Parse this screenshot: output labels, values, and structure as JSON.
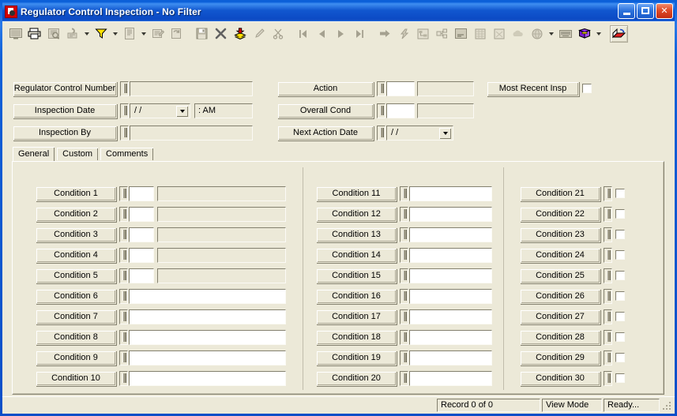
{
  "window": {
    "title": "Regulator Control Inspection - No Filter",
    "icon": "app-icon",
    "minimize_label": "Minimize",
    "maximize_label": "Maximize",
    "close_label": "Close"
  },
  "toolbar": {
    "groups": [
      {
        "buttons": [
          {
            "name": "screen-view-icon",
            "glyph": "screen",
            "framed": false,
            "enabled": false
          },
          {
            "name": "print-icon",
            "glyph": "printer",
            "framed": false,
            "enabled": true
          },
          {
            "name": "print-preview-icon",
            "glyph": "preview",
            "framed": false,
            "enabled": false
          },
          {
            "name": "find-icon",
            "glyph": "find",
            "framed": false,
            "enabled": false,
            "dropdown": true
          },
          {
            "name": "filter-icon",
            "glyph": "funnel",
            "framed": false,
            "enabled": true,
            "dropdown": true
          },
          {
            "name": "report-icon",
            "glyph": "report",
            "framed": false,
            "enabled": false,
            "dropdown": true
          },
          {
            "name": "properties-icon",
            "glyph": "properties",
            "framed": false,
            "enabled": false
          },
          {
            "name": "refresh-icon",
            "glyph": "refresh",
            "framed": false,
            "enabled": false
          }
        ]
      },
      {
        "buttons": [
          {
            "name": "save-icon",
            "glyph": "save",
            "framed": false,
            "enabled": false
          },
          {
            "name": "delete-icon",
            "glyph": "delete-x",
            "framed": false,
            "enabled": true
          },
          {
            "name": "add-record-icon",
            "glyph": "stack-add",
            "framed": false,
            "enabled": true
          },
          {
            "name": "edit-icon",
            "glyph": "pencil",
            "framed": false,
            "enabled": false
          },
          {
            "name": "cut-icon",
            "glyph": "scissors",
            "framed": false,
            "enabled": false
          }
        ]
      },
      {
        "buttons": [
          {
            "name": "first-record-icon",
            "glyph": "nav-first",
            "framed": false,
            "enabled": false
          },
          {
            "name": "previous-record-icon",
            "glyph": "nav-prev",
            "framed": false,
            "enabled": false
          },
          {
            "name": "next-record-icon",
            "glyph": "nav-next",
            "framed": false,
            "enabled": false
          },
          {
            "name": "last-record-icon",
            "glyph": "nav-last",
            "framed": false,
            "enabled": false
          }
        ]
      },
      {
        "buttons": [
          {
            "name": "goto-icon",
            "glyph": "arrow-right",
            "framed": false,
            "enabled": false
          },
          {
            "name": "lightning-icon",
            "glyph": "lightning",
            "framed": false,
            "enabled": false
          },
          {
            "name": "hierarchy-icon",
            "glyph": "hierarchy",
            "framed": false,
            "enabled": false
          },
          {
            "name": "tree-icon",
            "glyph": "tree",
            "framed": false,
            "enabled": false
          },
          {
            "name": "list-icon",
            "glyph": "list",
            "framed": false,
            "enabled": false
          },
          {
            "name": "grid-icon",
            "glyph": "grid",
            "framed": false,
            "enabled": false
          },
          {
            "name": "calculator-icon",
            "glyph": "calc",
            "framed": false,
            "enabled": false
          },
          {
            "name": "map-icon",
            "glyph": "map-cloud",
            "framed": false,
            "enabled": false
          },
          {
            "name": "globe-icon",
            "glyph": "globe",
            "framed": false,
            "enabled": false,
            "dropdown": true
          },
          {
            "name": "keyboard-icon",
            "glyph": "keyboard",
            "framed": false,
            "enabled": false
          },
          {
            "name": "help-book-icon",
            "glyph": "book",
            "framed": false,
            "enabled": true,
            "dropdown": true
          }
        ]
      },
      {
        "buttons": [
          {
            "name": "export-icon",
            "glyph": "export",
            "framed": true,
            "enabled": true
          }
        ]
      }
    ]
  },
  "header": {
    "fields": [
      {
        "name": "regulator-control-number",
        "label": "Regulator Control Number",
        "value": "",
        "type": "text"
      },
      {
        "name": "inspection-date",
        "label": "Inspection Date",
        "value": "  /  /",
        "type": "date",
        "time_value": "  :     AM"
      },
      {
        "name": "inspection-by",
        "label": "Inspection By",
        "value": "",
        "type": "text"
      },
      {
        "name": "action",
        "label": "Action",
        "value": "",
        "value2": "",
        "type": "code-desc"
      },
      {
        "name": "overall-cond",
        "label": "Overall Cond",
        "value": "",
        "value2": "",
        "type": "code-desc"
      },
      {
        "name": "next-action-date",
        "label": "Next Action Date",
        "value": "  /  /",
        "type": "date"
      }
    ],
    "most_recent_insp": {
      "label": "Most Recent Insp",
      "checked": false
    }
  },
  "tabs": [
    {
      "name": "tab-general",
      "label": "General",
      "active": true
    },
    {
      "name": "tab-custom",
      "label": "Custom",
      "active": false
    },
    {
      "name": "tab-comments",
      "label": "Comments",
      "active": false
    }
  ],
  "conditions": {
    "column1": [
      {
        "label": "Condition 1",
        "code": "",
        "desc": ""
      },
      {
        "label": "Condition 2",
        "code": "",
        "desc": ""
      },
      {
        "label": "Condition 3",
        "code": "",
        "desc": ""
      },
      {
        "label": "Condition 4",
        "code": "",
        "desc": ""
      },
      {
        "label": "Condition 5",
        "code": "",
        "desc": ""
      },
      {
        "label": "Condition 6",
        "desc": ""
      },
      {
        "label": "Condition 7",
        "desc": ""
      },
      {
        "label": "Condition 8",
        "desc": ""
      },
      {
        "label": "Condition 9",
        "desc": ""
      },
      {
        "label": "Condition 10",
        "desc": ""
      }
    ],
    "column2": [
      {
        "label": "Condition 11",
        "value": ""
      },
      {
        "label": "Condition 12",
        "value": ""
      },
      {
        "label": "Condition 13",
        "value": ""
      },
      {
        "label": "Condition 14",
        "value": ""
      },
      {
        "label": "Condition 15",
        "value": ""
      },
      {
        "label": "Condition 16",
        "value": ""
      },
      {
        "label": "Condition 17",
        "value": ""
      },
      {
        "label": "Condition 18",
        "value": ""
      },
      {
        "label": "Condition 19",
        "value": ""
      },
      {
        "label": "Condition 20",
        "value": ""
      }
    ],
    "column3": [
      {
        "label": "Condition 21",
        "checked": false
      },
      {
        "label": "Condition 22",
        "checked": false
      },
      {
        "label": "Condition 23",
        "checked": false
      },
      {
        "label": "Condition 24",
        "checked": false
      },
      {
        "label": "Condition 25",
        "checked": false
      },
      {
        "label": "Condition 26",
        "checked": false
      },
      {
        "label": "Condition 27",
        "checked": false
      },
      {
        "label": "Condition 28",
        "checked": false
      },
      {
        "label": "Condition 29",
        "checked": false
      },
      {
        "label": "Condition 30",
        "checked": false
      }
    ]
  },
  "statusbar": {
    "record": "Record 0 of 0",
    "mode": "View Mode",
    "state": "Ready..."
  },
  "colors": {
    "face": "#ece9d8",
    "title_blue": "#0a4fc8",
    "border_blue": "#0a24d6",
    "close_red": "#e04b28",
    "field_white": "#ffffff"
  }
}
